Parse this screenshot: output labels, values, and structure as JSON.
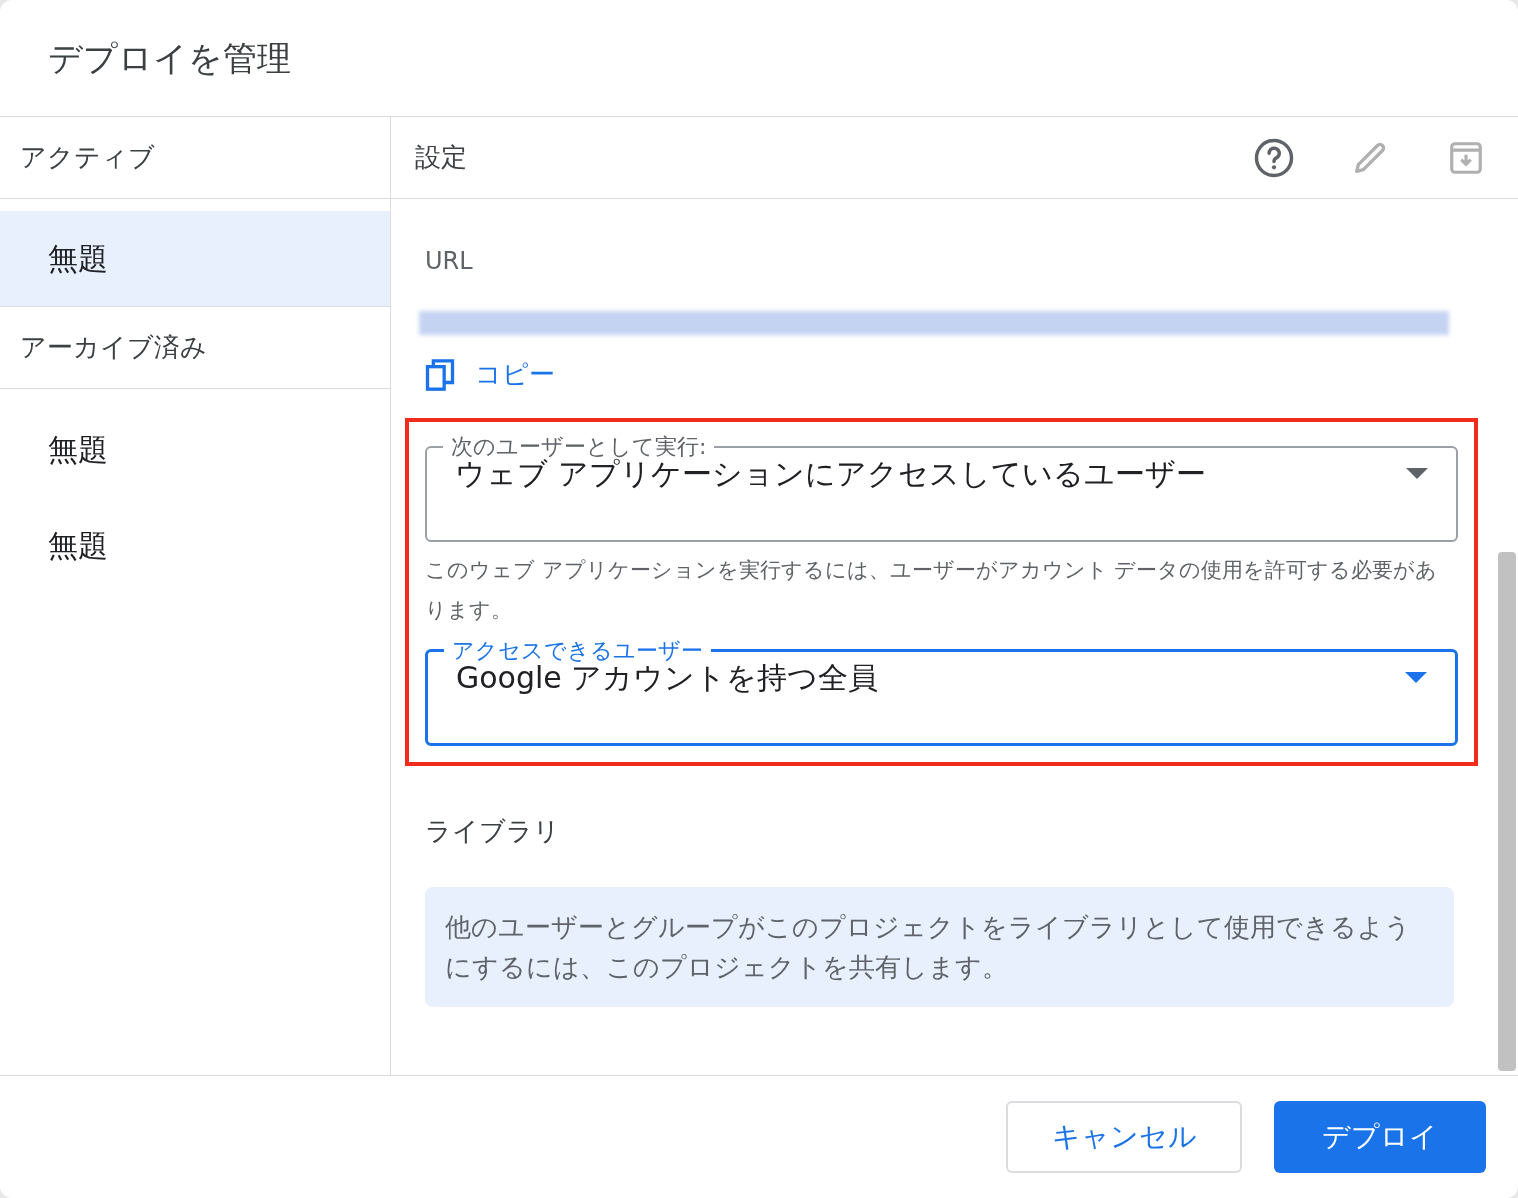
{
  "dialog": {
    "title": "デプロイを管理"
  },
  "sidebar": {
    "sections": [
      {
        "heading": "アクティブ",
        "items": [
          {
            "label": "無題",
            "selected": true
          }
        ]
      },
      {
        "heading": "アーカイブ済み",
        "items": [
          {
            "label": "無題",
            "selected": false
          },
          {
            "label": "無題",
            "selected": false
          }
        ]
      }
    ]
  },
  "panel": {
    "title": "設定",
    "toolbar": [
      {
        "kind": "help",
        "disabled": false
      },
      {
        "kind": "edit",
        "disabled": true
      },
      {
        "kind": "archive",
        "disabled": true
      }
    ],
    "url_label": "URL",
    "copy_link": "コピー",
    "fields": [
      {
        "label": "次のユーザーとして実行:",
        "value": "ウェブ アプリケーションにアクセスしているユーザー",
        "focused": false,
        "help": "このウェブ アプリケーションを実行するには、ユーザーがアカウント データの使用を許可する必要があります。"
      },
      {
        "label": "アクセスできるユーザー",
        "value": "Google アカウントを持つ全員",
        "focused": true
      }
    ],
    "library_heading": "ライブラリ",
    "library_note": "他のユーザーとグループがこのプロジェクトをライブラリとして使用できるようにするには、このプロジェクトを共有します。"
  },
  "buttons": [
    {
      "label": "キャンセル",
      "kind": "secondary"
    },
    {
      "label": "デプロイ",
      "kind": "primary"
    }
  ]
}
